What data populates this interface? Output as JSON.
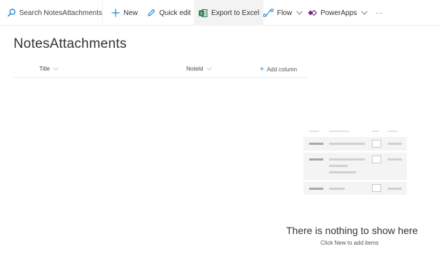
{
  "search": {
    "text": "Search NotesAttachments",
    "icon": "search-icon"
  },
  "toolbar": {
    "new_label": "New",
    "quick_edit_label": "Quick edit",
    "export_label": "Export to Excel",
    "flow_label": "Flow",
    "powerapps_label": "PowerApps",
    "more_label": "···"
  },
  "list": {
    "title": "NotesAttachments",
    "columns": [
      {
        "label": "Title"
      },
      {
        "label": "NoteId"
      }
    ],
    "add_column_label": "Add column"
  },
  "empty_state": {
    "title": "There is nothing to show here",
    "subtitle": "Click New to add items"
  },
  "colors": {
    "accent": "#0078d4",
    "excel_green": "#217346",
    "powerapps_purple": "#742774"
  }
}
